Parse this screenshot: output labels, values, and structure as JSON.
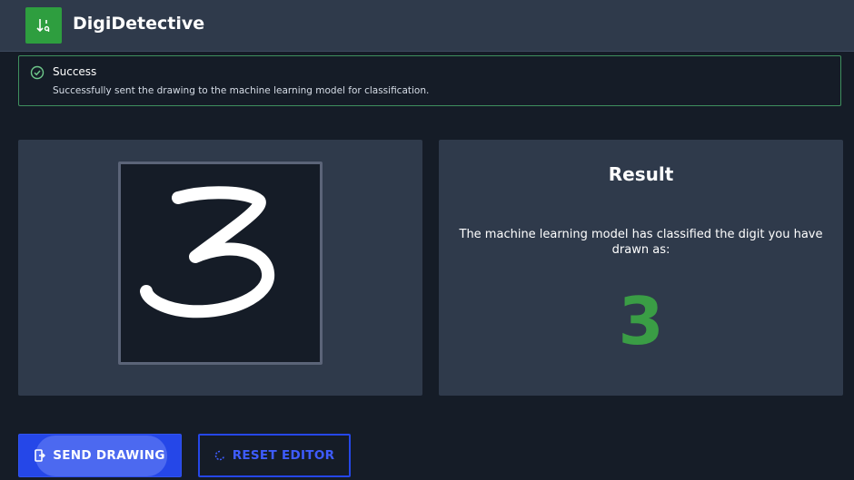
{
  "app": {
    "title": "DigiDetective",
    "logo_icon": "sort-digits-icon",
    "brand_color": "#2e9e3f"
  },
  "alert": {
    "title": "Success",
    "message": "Successfully sent the drawing to the machine learning model for classification.",
    "icon": "check-circle-icon"
  },
  "canvas": {
    "drawn_digit": "3"
  },
  "result": {
    "title": "Result",
    "description": "The machine learning model has classified the digit you have drawn as:",
    "digit": "3",
    "digit_color": "#3a9d45"
  },
  "buttons": {
    "send_label": "SEND DRAWING",
    "send_icon": "send-icon",
    "reset_label": "RESET EDITOR",
    "reset_icon": "refresh-icon"
  }
}
